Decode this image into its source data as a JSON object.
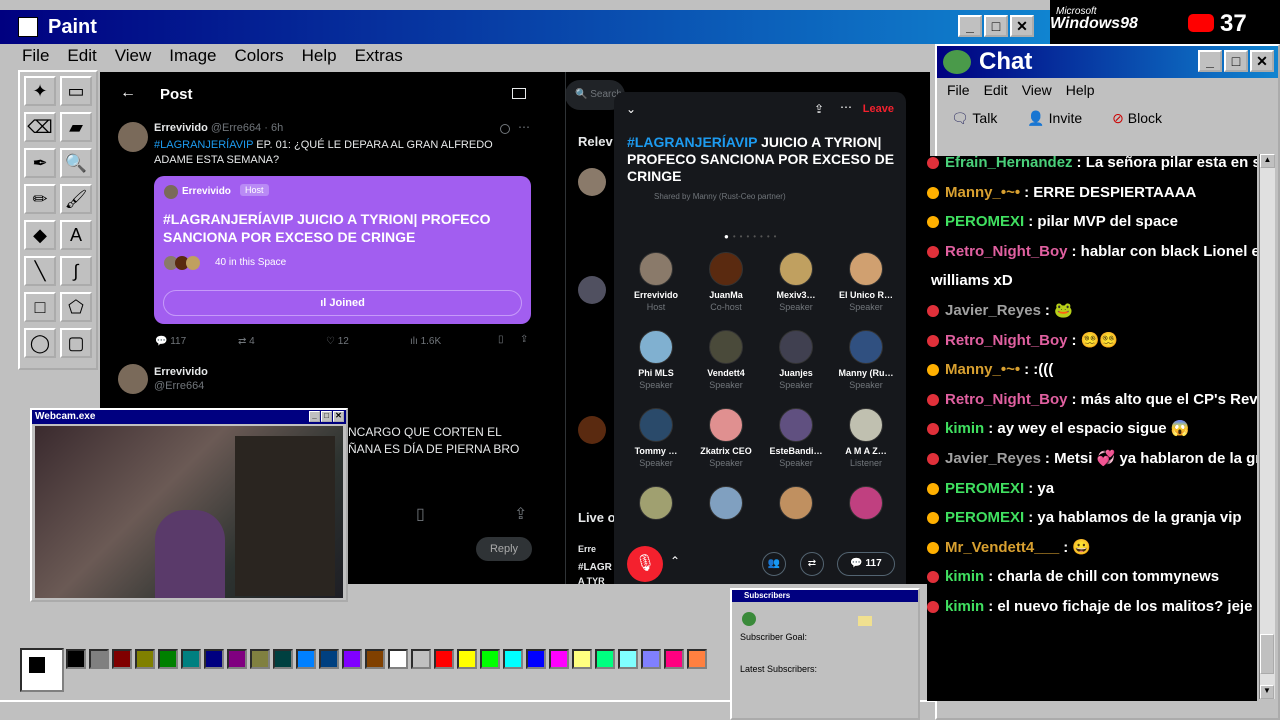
{
  "paint": {
    "title": "Paint",
    "menu": [
      "File",
      "Edit",
      "View",
      "Image",
      "Colors",
      "Help",
      "Extras"
    ],
    "tools": [
      "✦",
      "▭",
      "⌫",
      "▰",
      "✒",
      "🔍",
      "✏",
      "🖌",
      "◆",
      "A",
      "╲",
      "∫",
      "□",
      "⬠",
      "◯",
      "▢"
    ],
    "palette": [
      "#000000",
      "#808080",
      "#800000",
      "#808000",
      "#008000",
      "#008080",
      "#000080",
      "#800080",
      "#808040",
      "#004040",
      "#0080ff",
      "#004080",
      "#8000ff",
      "#804000",
      "#ffffff",
      "#c0c0c0",
      "#ff0000",
      "#ffff00",
      "#00ff00",
      "#00ffff",
      "#0000ff",
      "#ff00ff",
      "#ffff80",
      "#00ff80",
      "#80ffff",
      "#8080ff",
      "#ff0080",
      "#ff8040"
    ]
  },
  "window_buttons": {
    "min": "_",
    "max": "□",
    "close": "✕"
  },
  "twitter": {
    "header": "Post",
    "back": "←",
    "search_placeholder": "Search",
    "post1": {
      "name": "Errevivido",
      "handle": "@Erre664 · 6h",
      "hashtag": "#LAGRANJERÍAVIP",
      "text": " EP. 01: ¿QUÉ LE DEPARA AL GRAN ALFREDO ADAME ESTA SEMANA?",
      "card": {
        "host_name": "Errevivido",
        "host_badge": "Host",
        "title": "#LAGRANJERÍAVIP JUICIO A TYRION| PROFECO SANCIONA POR EXCESO DE CRINGE",
        "listeners": "40 in this Space",
        "joined": "Joined"
      },
      "stats": {
        "replies": "117",
        "reposts": "4",
        "likes": "12",
        "views": "1.6K"
      }
    },
    "post2": {
      "name": "Errevivido",
      "handle": "@Erre664",
      "text_line1": "NCARGO QUE CORTEN EL",
      "text_line2": "ÑANA ES DÍA DE PIERNA BRO",
      "reply": "Reply"
    },
    "right": {
      "relevant": "Relev",
      "live": "Live o",
      "live_name": "Erre",
      "live_tag": "#LAGR",
      "live_tag2": "A TYR"
    }
  },
  "space": {
    "leave": "Leave",
    "hashtag": "#LAGRANJERÍAVIP",
    "title_rest": " JUICIO A TYRION| PROFECO SANCIONA POR EXCESO DE CRINGE",
    "shared_by": "Shared by Manny (Rust-Ceo partner)",
    "speakers": [
      {
        "name": "Errevivido",
        "role": "Host",
        "color": "#8a7a6a"
      },
      {
        "name": "JuanMa",
        "role": "Co-host",
        "color": "#5a2a10"
      },
      {
        "name": "Mexiv3…",
        "role": "Speaker",
        "color": "#c0a060"
      },
      {
        "name": "El Unico R…",
        "role": "Speaker",
        "color": "#d0a070"
      },
      {
        "name": "Phi MLS",
        "role": "Speaker",
        "color": "#80b0d0"
      },
      {
        "name": "Vendett4",
        "role": "Speaker",
        "color": "#4a4a3a"
      },
      {
        "name": "Juanjes",
        "role": "Speaker",
        "color": "#404050"
      },
      {
        "name": "Manny (Ru…",
        "role": "Speaker",
        "color": "#305080"
      },
      {
        "name": "Tommy …",
        "role": "Speaker",
        "color": "#2a4a6a"
      },
      {
        "name": "Zkatrix CEO",
        "role": "Speaker",
        "color": "#e09090"
      },
      {
        "name": "EsteBandi…",
        "role": "Speaker",
        "color": "#605080"
      },
      {
        "name": "A M A Z…",
        "role": "Listener",
        "color": "#c0c0b0"
      },
      {
        "name": "",
        "role": "",
        "color": "#a0a070"
      },
      {
        "name": "",
        "role": "",
        "color": "#80a0c0"
      },
      {
        "name": "",
        "role": "",
        "color": "#c09060"
      },
      {
        "name": "",
        "role": "",
        "color": "#c04080"
      }
    ],
    "count": "117"
  },
  "webcam": {
    "title": "Webcam.exe"
  },
  "subscribers": {
    "title": "Subscribers",
    "goal": "Subscriber Goal:",
    "latest": "Latest Subscribers:"
  },
  "chat": {
    "title": "Chat",
    "menu": [
      "File",
      "Edit",
      "View",
      "Help"
    ],
    "toolbar": [
      "Talk",
      "Invite",
      "Block"
    ],
    "messages": [
      {
        "badge": "#e0303a",
        "user": "Efrain_Hernandez",
        "color": "#4ad07a",
        "text": ": La señora pilar esta en su"
      },
      {
        "badge": "#ffb000",
        "user": "Manny_•~•",
        "color": "#d8a030",
        "text": ": ERRE DESPIERTAAAA"
      },
      {
        "badge": "#ffb000",
        "user": "PEROMEXI",
        "color": "#40e060",
        "text": ": pilar MVP del space"
      },
      {
        "badge": "#e0303a",
        "user": "Retro_Night_Boy",
        "color": "#e060a0",
        "text": ": hablar con black Lionel es c"
      },
      {
        "badge": "",
        "user": "",
        "color": "#fff",
        "text": "williams xD"
      },
      {
        "badge": "#e0303a",
        "user": "Javier_Reyes",
        "color": "#a0a0a0",
        "text": ": 🐸"
      },
      {
        "badge": "#e0303a",
        "user": "Retro_Night_Boy",
        "color": "#e060a0",
        "text": ": 😵‍💫😵‍💫"
      },
      {
        "badge": "#ffb000",
        "user": "Manny_•~•",
        "color": "#d8a030",
        "text": ": :((("
      },
      {
        "badge": "#e0303a",
        "user": "Retro_Night_Boy",
        "color": "#e060a0",
        "text": ": más alto que el CP's Review"
      },
      {
        "badge": "#e0303a",
        "user": "kimin",
        "color": "#40e060",
        "text": ": ay wey el espacio sigue 😱"
      },
      {
        "badge": "#e0303a",
        "user": "Javier_Reyes",
        "color": "#a0a0a0",
        "text": ": Metsi 💞 ya hablaron de la gra"
      },
      {
        "badge": "#ffb000",
        "user": "PEROMEXI",
        "color": "#40e060",
        "text": ": ya"
      },
      {
        "badge": "#ffb000",
        "user": "PEROMEXI",
        "color": "#40e060",
        "text": ": ya hablamos de la granja vip"
      },
      {
        "badge": "#ffb000",
        "user": "Mr_Vendett4___",
        "color": "#d8a030",
        "text": ": 😀"
      },
      {
        "badge": "#e0303a",
        "user": "kimin",
        "color": "#40e060",
        "text": ": charla de chill con tommynews"
      },
      {
        "badge": "#e0303a",
        "user": "kimin",
        "color": "#40e060",
        "text": ": el nuevo fichaje de los malitos? jeje"
      }
    ]
  },
  "overlay": {
    "brand_top": "Microsoft",
    "brand": "Windows98",
    "viewers": "37"
  }
}
